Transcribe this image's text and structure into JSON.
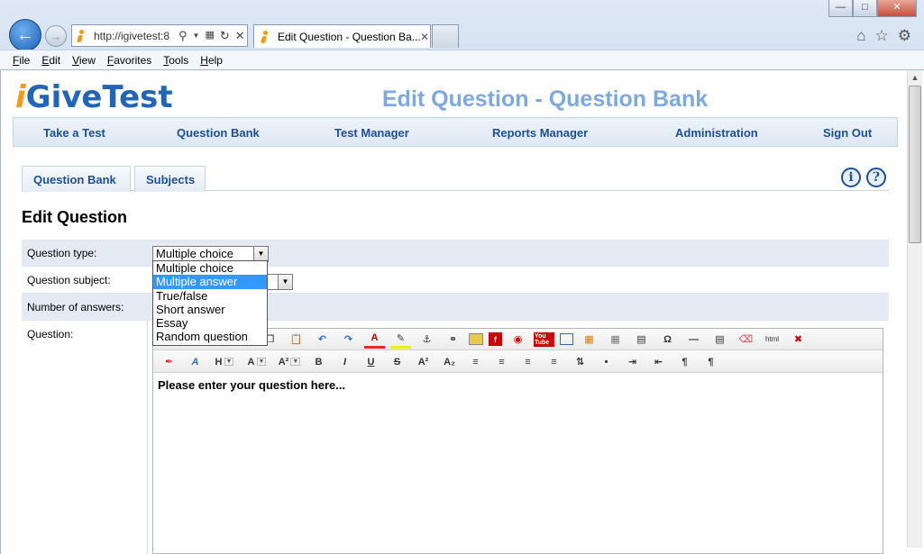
{
  "browser": {
    "url": "http://igivetest:8",
    "tab_title": "Edit Question - Question Ba...",
    "menu": [
      "File",
      "Edit",
      "View",
      "Favorites",
      "Tools",
      "Help"
    ],
    "window_controls": {
      "minimize": "—",
      "maximize": "□",
      "close": "✕"
    }
  },
  "site": {
    "logo_i": "i",
    "logo_rest": "GiveTest",
    "page_heading": "Edit Question - Question Bank"
  },
  "nav": [
    {
      "label": "Take a Test"
    },
    {
      "label": "Question Bank"
    },
    {
      "label": "Test Manager"
    },
    {
      "label": "Reports Manager"
    },
    {
      "label": "Administration"
    },
    {
      "label": "Sign Out"
    }
  ],
  "subtabs": [
    {
      "label": "Question Bank"
    },
    {
      "label": "Subjects"
    }
  ],
  "section_title": "Edit Question",
  "form": {
    "question_type_label": "Question type:",
    "question_type_value": "Multiple choice",
    "question_subject_label": "Question subject:",
    "number_of_answers_label": "Number of answers:",
    "question_label": "Question:",
    "question_type_options": [
      "Multiple choice",
      "Multiple answer",
      "True/false",
      "Short answer",
      "Essay",
      "Random question"
    ],
    "highlighted_option": "Multiple answer"
  },
  "editor": {
    "content": "Please enter your question here...",
    "row1_icons": [
      "copy-icon",
      "paste-icon",
      "undo-icon",
      "redo-icon",
      "font-color-icon",
      "highlight-color-icon",
      "anchor-icon",
      "link-icon",
      "image-icon",
      "flash-icon",
      "media-icon",
      "youtube-icon",
      "table-icon",
      "table-insert-icon",
      "grid-icon",
      "template-icon",
      "special-char-icon",
      "horizontal-rule-icon",
      "page-break-icon",
      "eraser-icon",
      "html-source-icon",
      "delete-icon"
    ],
    "row2": {
      "heading": "H",
      "font_size": "A",
      "superscript_size": "A²",
      "bold": "B",
      "italic": "I",
      "underline": "U",
      "strike": "S",
      "superscript": "A²",
      "subscript": "A₂",
      "paragraph_ltr": "¶",
      "paragraph_rtl": "¶"
    },
    "youtube_text": "You Tube",
    "special_char": "Ω",
    "html_text": "html"
  },
  "colors": {
    "brand_blue": "#2264b5",
    "brand_orange": "#f29a1a",
    "heading_blue": "#7ea9dc",
    "nav_text": "#1d4f95",
    "highlight": "#3399ff"
  }
}
